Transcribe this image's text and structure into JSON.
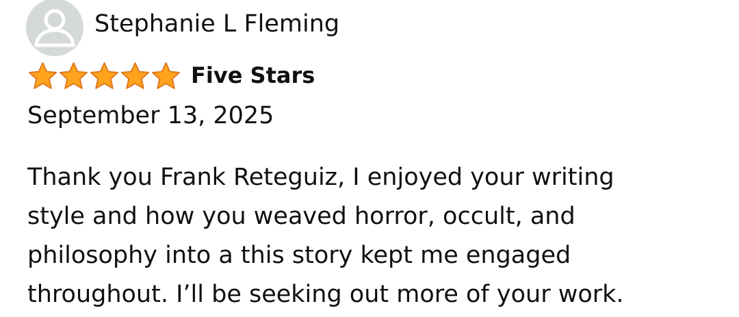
{
  "review": {
    "reviewer_name": "Stephanie L Fleming",
    "rating": 5,
    "rating_max": 5,
    "title": "Five Stars",
    "date": "September 13, 2025",
    "body": "Thank you Frank Reteguiz, I enjoyed your writing style and how you weaved horror, occult, and philosophy into a this story kept me engaged throughout. I’ll be seeking out more of your work.",
    "avatar_icon": "user-silhouette-icon",
    "star_icon": "star-icon"
  },
  "colors": {
    "star_fill": "#ffa41c",
    "star_stroke": "#de7921",
    "avatar_bg": "#d5d9d9",
    "avatar_fg": "#ffffff",
    "text": "#0f1111"
  }
}
